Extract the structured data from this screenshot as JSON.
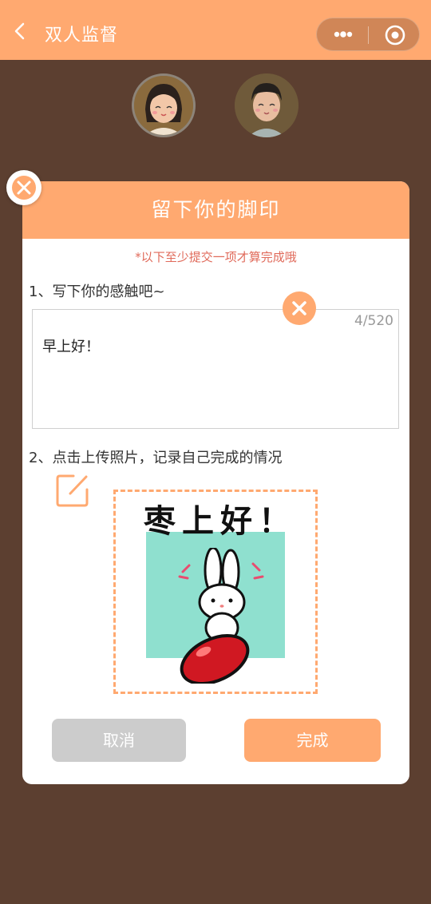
{
  "header": {
    "title": "双人监督",
    "back_icon": "chevron-left-icon",
    "menu_icons": [
      "more-dots-icon",
      "target-icon"
    ],
    "accent": "#ffa970"
  },
  "users": {
    "avatars": [
      "girl-avatar",
      "boy-avatar"
    ]
  },
  "modal": {
    "title": "留下你的脚印",
    "notice": "*以下至少提交一项才算完成哦",
    "question1": "1、写下你的感触吧~",
    "counter": "4/520",
    "text_value": "早上好！",
    "question2": "2、点击上传照片，记录自己完成的情况",
    "photo_caption": "枣上好！",
    "cancel_label": "取消",
    "done_label": "完成"
  }
}
